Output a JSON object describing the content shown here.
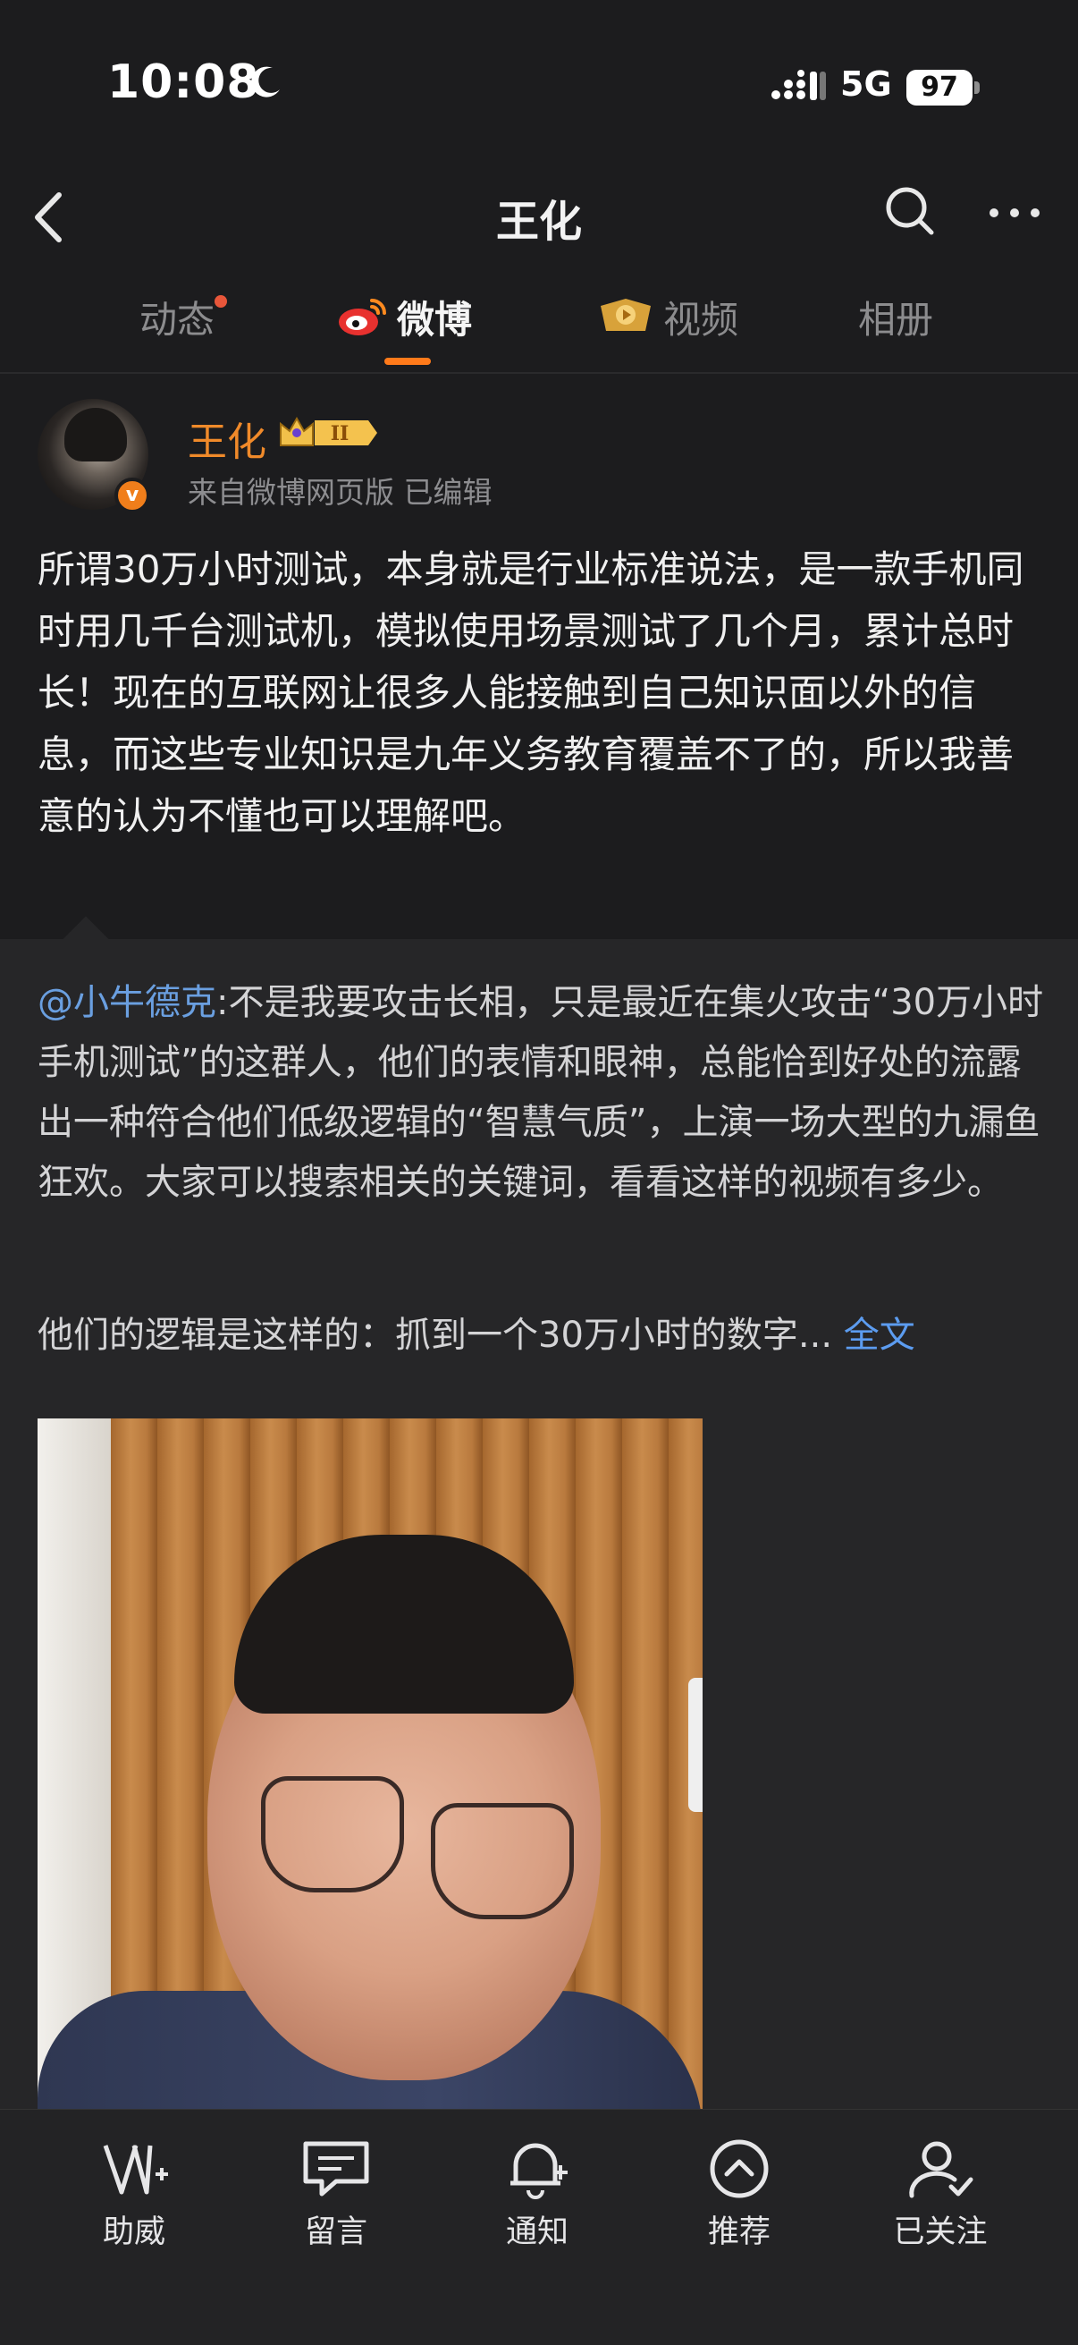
{
  "status_bar": {
    "time": "10:08",
    "network": "5G",
    "battery": "97"
  },
  "header": {
    "title": "王化"
  },
  "tabs": [
    {
      "label": "动态",
      "has_dot": true
    },
    {
      "label": "微博",
      "active": true
    },
    {
      "label": "视频"
    },
    {
      "label": "相册"
    }
  ],
  "post": {
    "username": "王化",
    "meta": "来自微博网页版  已编辑",
    "text": "所谓30万小时测试，本身就是行业标准说法，是一款手机同时用几千台测试机，模拟使用场景测试了几个月，累计总时长！现在的互联网让很多人能接触到自己知识面以外的信息，而这些专业知识是九年义务教育覆盖不了的，所以我善意的认为不懂也可以理解吧。"
  },
  "quoted": {
    "mention": "@小牛德克",
    "text": ":不是我要攻击长相，只是最近在集火攻击“30万小时手机测试”的这群人，他们的表情和眼神，总能恰到好处的流露出一种符合他们低级逻辑的“智慧气质”，上演一场大型的九漏鱼狂欢。大家可以搜索相关的关键词，看看这样的视频有多少。",
    "line2": "他们的逻辑是这样的：抓到一个30万小时的数字...",
    "fulltext_link": "全文"
  },
  "bottom_bar": [
    {
      "label": "助威",
      "icon": "cheer-icon"
    },
    {
      "label": "留言",
      "icon": "comment-icon"
    },
    {
      "label": "通知",
      "icon": "bell-icon"
    },
    {
      "label": "推荐",
      "icon": "recommend-icon"
    },
    {
      "label": "已关注",
      "icon": "followed-icon"
    }
  ],
  "colors": {
    "background": "#1c1c1e",
    "accent": "#ff7a1a",
    "username": "#f08a2a",
    "link": "#5c9cf0"
  }
}
